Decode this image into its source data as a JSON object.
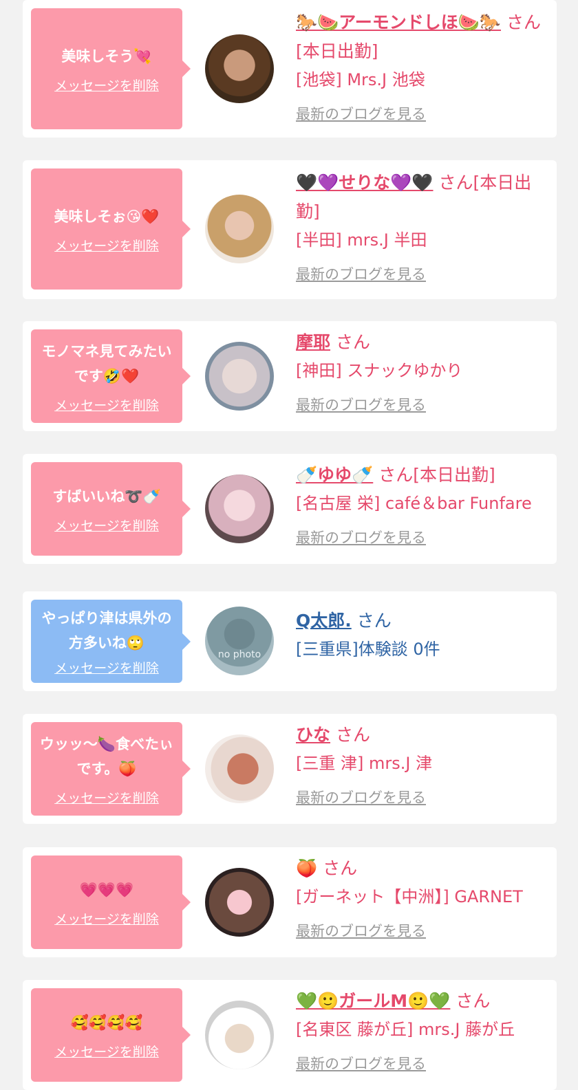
{
  "cards": [
    {
      "bubble": {
        "message": "美味しそう💘",
        "delete": "メッセージを削除",
        "color": "pink"
      },
      "name": "🐎🍉アーモンドしほ🍉🐎",
      "suffix": "さん[本日出勤]",
      "shop": "[池袋] Mrs.J 池袋",
      "blog": "最新のブログを見る"
    },
    {
      "bubble": {
        "message": "美味しそぉ😘❤️",
        "delete": "メッセージを削除",
        "color": "pink"
      },
      "name": "🖤💜せりな💜🖤",
      "suffix": "さん[本日出勤]",
      "shop": "[半田] mrs.J 半田",
      "blog": "最新のブログを見る"
    },
    {
      "bubble": {
        "message": "モノマネ見てみたいです🤣❤️",
        "delete": "メッセージを削除",
        "color": "pink"
      },
      "name": "摩耶",
      "suffix": "さん",
      "shop": "[神田] スナックゆかり",
      "blog": "最新のブログを見る"
    },
    {
      "bubble": {
        "message": "すばいいね➰🍼",
        "delete": "メッセージを削除",
        "color": "pink"
      },
      "name": "🍼ゆゆ🍼",
      "suffix": "さん[本日出勤]",
      "shop": "[名古屋 栄] café＆bar Funfare",
      "blog": "最新のブログを見る"
    },
    {
      "bubble": {
        "message": "やっぱり津は県外の方多いね🙄",
        "delete": "メッセージを削除",
        "color": "blue"
      },
      "name": "Q太郎.",
      "suffix": "さん",
      "shop": "[三重県]体験談 0件",
      "avatar_text": "no photo"
    },
    {
      "bubble": {
        "message": "ウッッ～🍆食べたぃです。🍑",
        "delete": "メッセージを削除",
        "color": "pink"
      },
      "name": "ひな",
      "suffix": "さん",
      "shop": "[三重 津] mrs.J 津",
      "blog": "最新のブログを見る"
    },
    {
      "bubble": {
        "message": "💗💗💗",
        "delete": "メッセージを削除",
        "color": "pink"
      },
      "name": "🍑",
      "suffix": "さん",
      "shop": "[ガーネット【中洲】] GARNET",
      "blog": "最新のブログを見る"
    },
    {
      "bubble": {
        "message": "🥰🥰🥰🥰",
        "delete": "メッセージを削除",
        "color": "pink"
      },
      "name": "💚🙂ガールM🙂💚",
      "suffix": "さん",
      "shop": "[名東区 藤が丘] mrs.J 藤が丘",
      "blog": "最新のブログを見る"
    }
  ],
  "colors": {
    "pink_bubble": "#fc9aaa",
    "blue_bubble": "#8cbbf4",
    "name_pink": "#e5496b",
    "name_blue": "#2f64a4",
    "blog_gray": "#9a9a9a"
  }
}
